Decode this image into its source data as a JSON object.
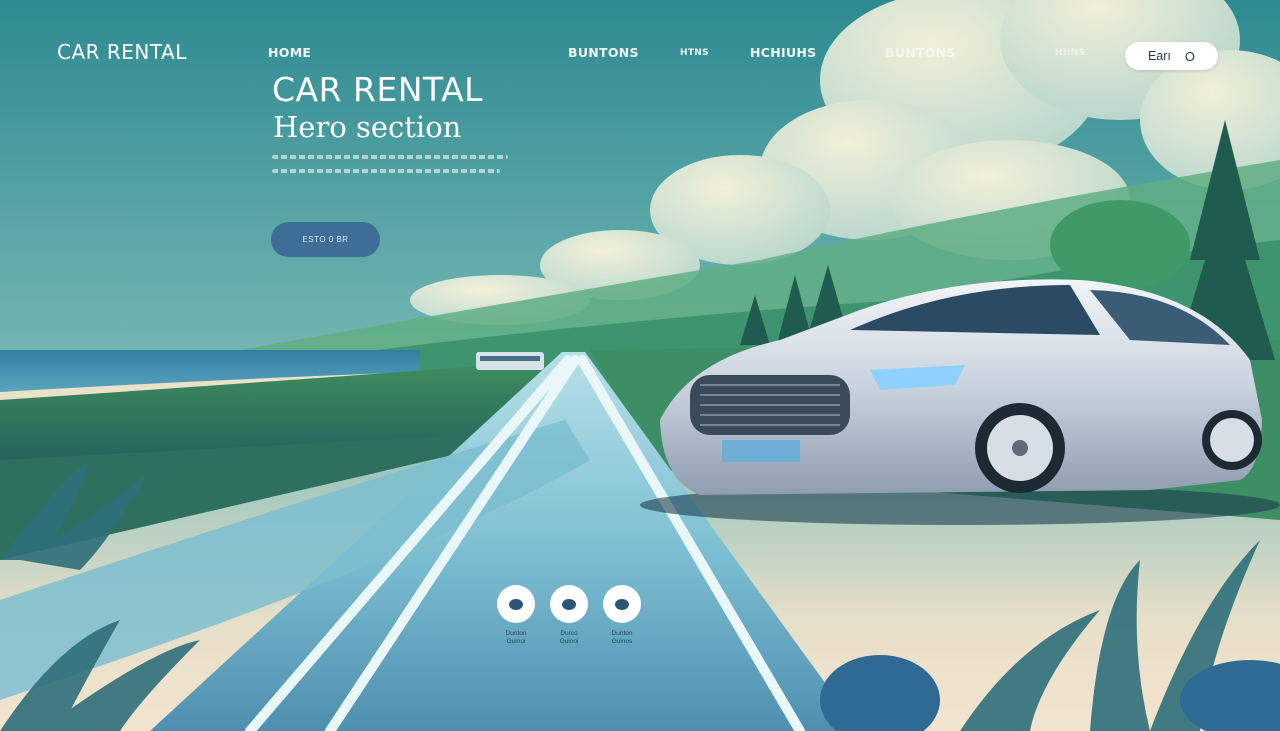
{
  "nav": {
    "logo": "CAR RENTAL",
    "links": [
      "HOME",
      "BUNTONS",
      "HTNS",
      "HCHIUHS",
      "BUNTONS",
      "HHNS"
    ],
    "cta_label": "Earı",
    "cta_icon": "O"
  },
  "hero": {
    "title": "CAR RENTAL",
    "subtitle": "Hero section",
    "button_label": "ESTO 0 BR"
  },
  "features": [
    {
      "label": "Dunton\nGuinoi",
      "icon": "circle-icon"
    },
    {
      "label": "Durco\nGuinoi",
      "icon": "circle-icon"
    },
    {
      "label": "Dunton\nGuinos",
      "icon": "circle-icon"
    }
  ],
  "colors": {
    "sky_top": "#2d8a91",
    "sky_horizon": "#f3e4cf",
    "road": "#7fc1d3",
    "car_body": "#d9e1ea",
    "cta_bg": "#3e6d97"
  }
}
